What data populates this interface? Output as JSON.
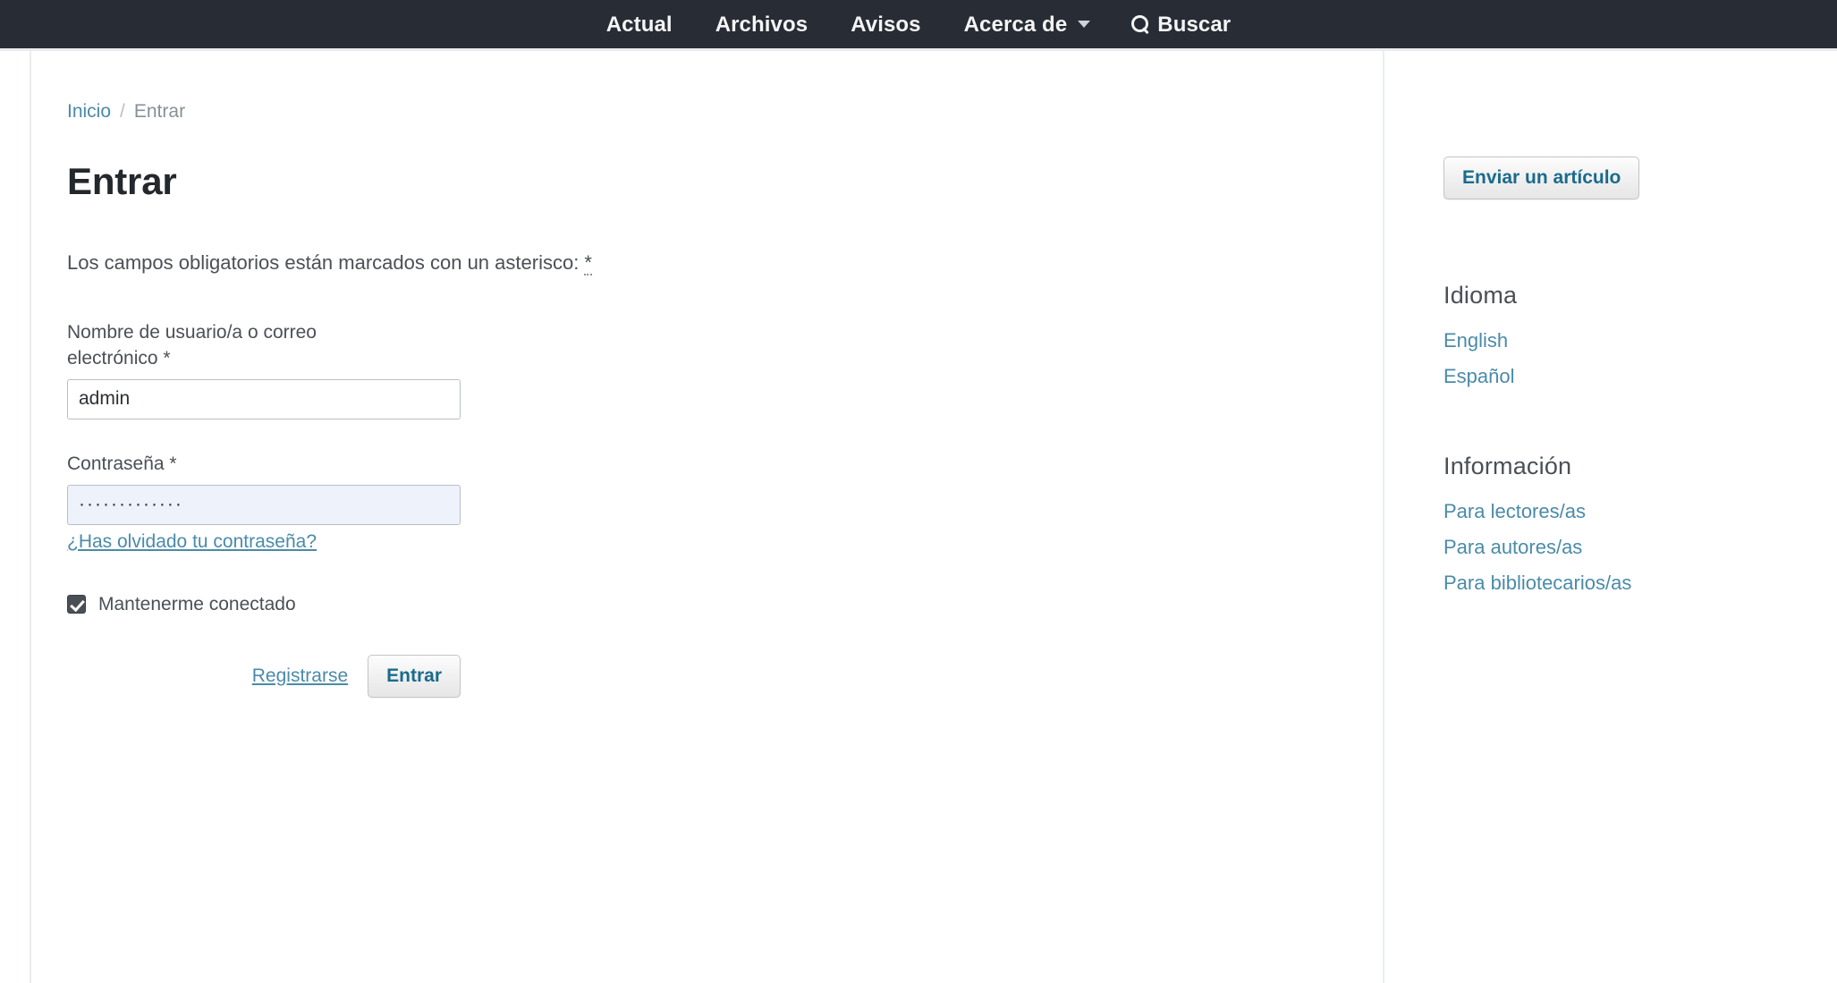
{
  "nav": {
    "items": [
      {
        "label": "Actual",
        "icon": null,
        "caret": false
      },
      {
        "label": "Archivos",
        "icon": null,
        "caret": false
      },
      {
        "label": "Avisos",
        "icon": null,
        "caret": false
      },
      {
        "label": "Acerca de",
        "icon": null,
        "caret": true
      },
      {
        "label": "Buscar",
        "icon": "search-icon",
        "caret": false
      }
    ],
    "background_color": "#282c34"
  },
  "breadcrumb": {
    "home_label": "Inicio",
    "separator": "/",
    "current_label": "Entrar"
  },
  "main": {
    "page_title": "Entrar",
    "required_note_prefix": "Los campos obligatorios están marcados con un asterisco: ",
    "required_note_asterisk": "*",
    "form": {
      "username": {
        "label": "Nombre de usuario/a o correo electrónico *",
        "value": "admin",
        "placeholder": ""
      },
      "password": {
        "label": "Contraseña *",
        "value": "·············",
        "placeholder": ""
      },
      "forgot_password_label": "¿Has olvidado tu contraseña?",
      "remember_label": "Mantenerme conectado",
      "remember_checked": true,
      "register_label": "Registrarse",
      "submit_label": "Entrar"
    }
  },
  "sidebar": {
    "submit_article_label": "Enviar un artículo",
    "language": {
      "title": "Idioma",
      "items": [
        {
          "label": "English"
        },
        {
          "label": "Español"
        }
      ]
    },
    "information": {
      "title": "Información",
      "items": [
        {
          "label": "Para lectores/as"
        },
        {
          "label": "Para autores/as"
        },
        {
          "label": "Para bibliotecarios/as"
        }
      ]
    }
  },
  "colors": {
    "nav_background": "#282c34",
    "link": "#4a8ba8",
    "text": "#4b5056",
    "heading": "#23282d",
    "autofill_background": "#eef2fa"
  }
}
